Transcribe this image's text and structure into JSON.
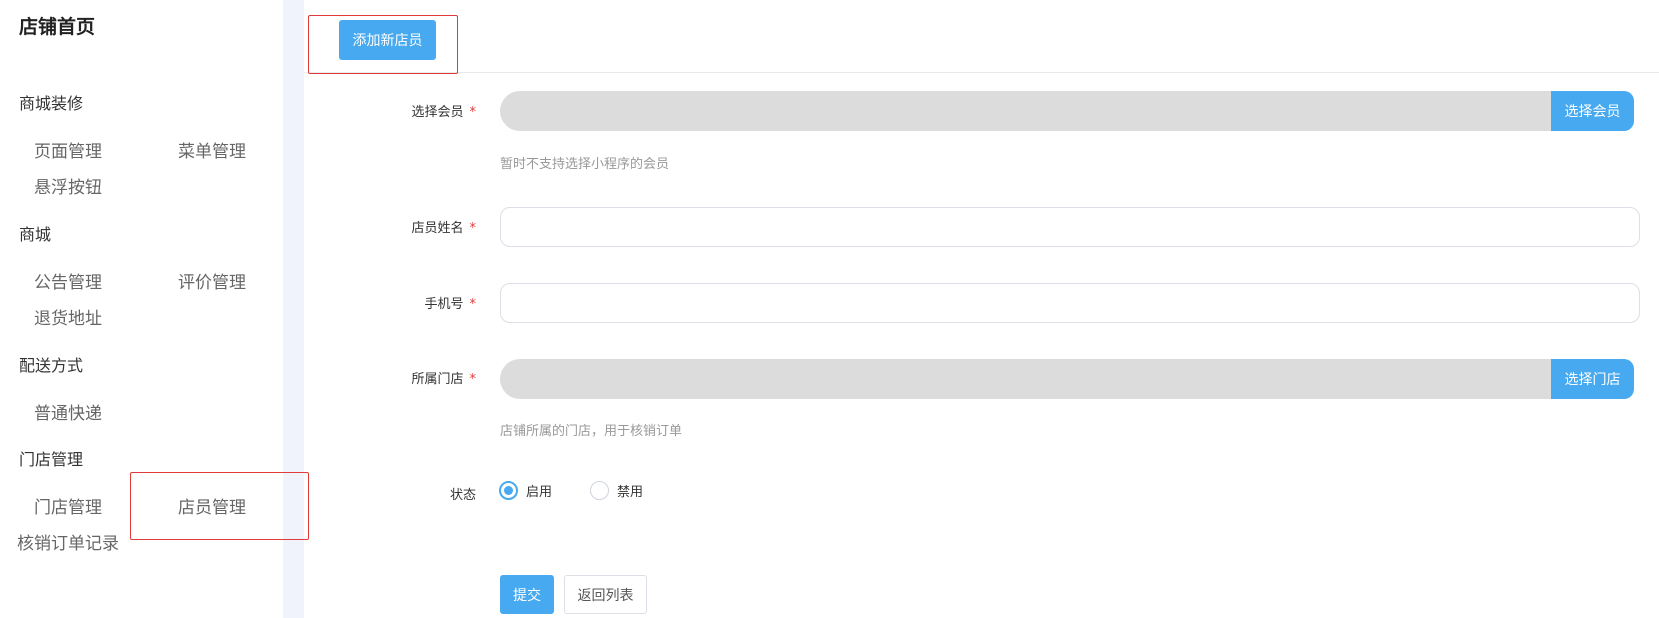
{
  "sidebar": {
    "title": "店铺首页",
    "sections": [
      {
        "title": "商城装修",
        "items": [
          "页面管理",
          "菜单管理",
          "悬浮按钮"
        ]
      },
      {
        "title": "商城",
        "items": [
          "公告管理",
          "评价管理",
          "退货地址"
        ]
      },
      {
        "title": "配送方式",
        "items": [
          "普通快递"
        ]
      },
      {
        "title": "门店管理",
        "items": [
          "门店管理",
          "店员管理",
          "核销订单记录"
        ]
      }
    ]
  },
  "toolbar": {
    "add_label": "添加新店员"
  },
  "form": {
    "member": {
      "label": "选择会员",
      "button": "选择会员",
      "hint": "暂时不支持选择小程序的会员"
    },
    "name": {
      "label": "店员姓名",
      "value": ""
    },
    "phone": {
      "label": "手机号",
      "value": ""
    },
    "store": {
      "label": "所属门店",
      "button": "选择门店",
      "hint": "店铺所属的门店，用于核销订单"
    },
    "status": {
      "label": "状态",
      "options": [
        "启用",
        "禁用"
      ],
      "selected": "启用"
    },
    "required_mark": "*",
    "submit_label": "提交",
    "back_label": "返回列表"
  },
  "colors": {
    "accent": "#47a9ef",
    "highlight": "#e03b3b",
    "disabled_bg": "#dcdcdc"
  }
}
